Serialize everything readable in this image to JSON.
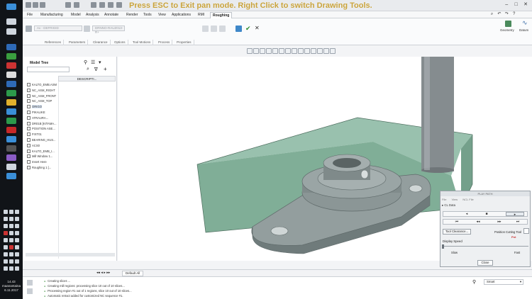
{
  "banner": "Press ESC to Exit pan mode.  Right Click to switch Drawing Tools.",
  "taskbar": {
    "clock_time": "14.43",
    "clock_day": "maanantaina",
    "clock_date": "6.11.2017"
  },
  "menu": {
    "tabs": [
      "File",
      "Manufacturing",
      "Model",
      "Analysis",
      "Annotate",
      "Render",
      "Tools",
      "View",
      "Applications",
      "RMI",
      "Roughing"
    ],
    "active": "Roughing"
  },
  "ribbon": {
    "field1": "Ax - DEFRIGID",
    "field2": "DRNNO-RAUZ013-R+",
    "subtabs": [
      "References",
      "Parameters",
      "Clearance",
      "Options",
      "Tool Motions",
      "Process",
      "Properties"
    ],
    "geometry_label": "Geometry",
    "datum_label": "Datum",
    "pause_label": "||",
    "ok_label": "✔",
    "cancel_label": "✕"
  },
  "model_tree": {
    "title": "Model Tree",
    "column": "DESCRIPTI...",
    "items": [
      {
        "label": "KALTO_EMB.ASM",
        "hl": false
      },
      {
        "label": "NC_ASM_RIGHT",
        "hl": false
      },
      {
        "label": "NC_ASM_FRONT",
        "hl": false
      },
      {
        "label": "NC_ASM_TOP",
        "hl": false
      },
      {
        "label": "ORIGO",
        "hl": true
      },
      {
        "label": "PIKALIKE",
        "hl": false
      },
      {
        "label": "ATRAURA...",
        "hl": false
      },
      {
        "label": "DR01B [KITAMA...",
        "hl": false
      },
      {
        "label": "POSITION ASE...",
        "hl": false
      },
      {
        "label": "FIXT01",
        "hl": false
      },
      {
        "label": "BEARING_HUS...",
        "hl": false
      },
      {
        "label": "ACS0",
        "hl": false
      },
      {
        "label": "KALTO_EMB_I...",
        "hl": false
      },
      {
        "label": "Mill Window 1...",
        "hl": false
      },
      {
        "label": "Insert Here",
        "hl": false
      },
      {
        "label": "Roughing 1 [...",
        "hl": false
      }
    ]
  },
  "play_path": {
    "title": "PLAY PATH",
    "menu": [
      "File",
      "View",
      "NCL File"
    ],
    "cl_data": "CL Data",
    "tool_clearance": "Tool Clearance...",
    "position_label": "Position Cutting Tool",
    "pnt_label": "Pnt",
    "display_speed": "Display Speed",
    "slow": "Slow",
    "fast": "Fast",
    "close": "Close"
  },
  "bottom": {
    "default_tab": "Default All",
    "messages": [
      "Creating slices ...",
      "Creating mill regions: processing slice 10 out of 10 slices...",
      "Processing region #1 out of 1 regions, slice 10 out of 10 slices...",
      "Automatic retract added for customized NC sequence #1."
    ],
    "smart_select": "Smart"
  },
  "colors": {
    "stock": "#6fa58c",
    "part": "#8f9a9a",
    "tool": "#7e8689",
    "banner": "#c8a23a"
  }
}
